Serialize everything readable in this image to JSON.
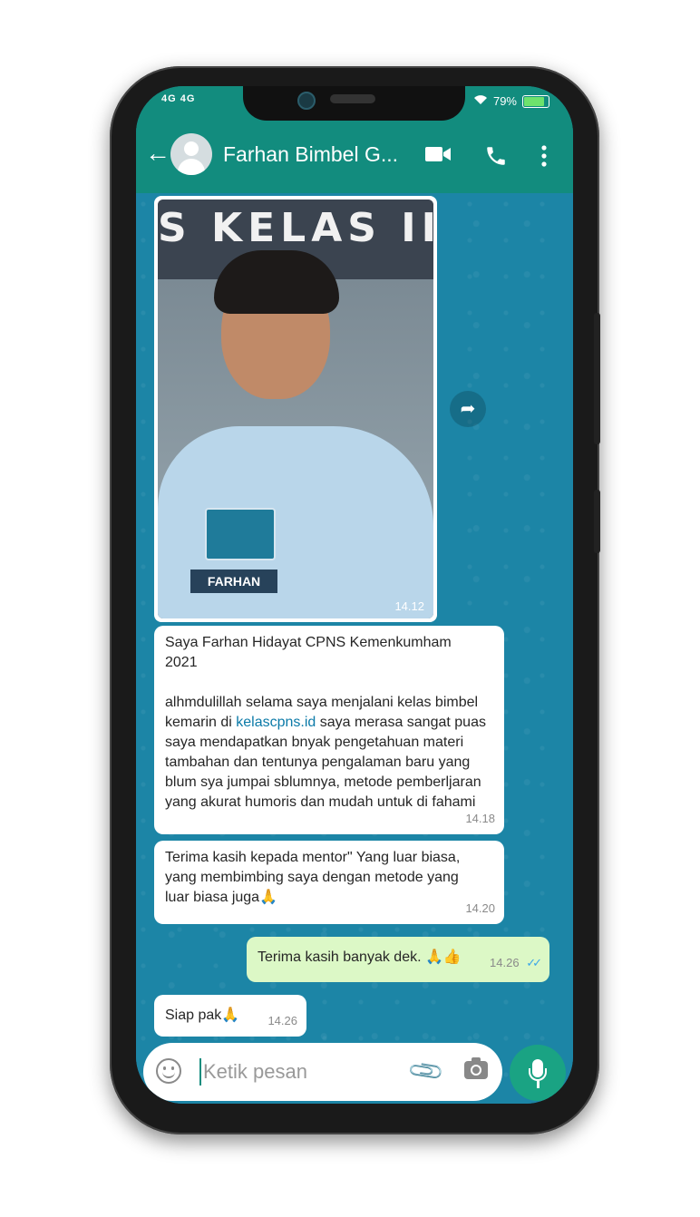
{
  "status_bar": {
    "network_left": "4G  4G",
    "battery_percent": "79%",
    "battery_level": 0.79
  },
  "header": {
    "back_icon": "arrow-left-icon",
    "contact_name": "Farhan Bimbel G...",
    "icons": [
      "video-call-icon",
      "phone-icon",
      "more-vert-icon"
    ]
  },
  "photo_message": {
    "sign_text": "S KELAS II",
    "badge_text": "FARHAN",
    "time": "14.12"
  },
  "messages": [
    {
      "direction": "in",
      "line1": "Saya Farhan Hidayat CPNS Kemenkumham",
      "line2": "2021",
      "para_before_link": "alhmdulillah selama saya menjalani kelas bimbel kemarin di ",
      "link": "kelascpns.id",
      "para_after_link": " saya merasa sangat puas saya mendapatkan bnyak pengetahuan materi tambahan dan tentunya pengalaman baru yang blum sya jumpai sblumnya, metode pemberljaran yang akurat humoris dan mudah untuk di fahami",
      "time": "14.18"
    },
    {
      "direction": "in",
      "text": "Terima kasih kepada mentor\" Yang luar biasa, yang membimbing saya dengan metode yang luar biasa juga🙏",
      "time": "14.20"
    },
    {
      "direction": "out",
      "text": "Terima kasih banyak dek. 🙏👍",
      "time": "14.26",
      "ticks": "✓✓"
    },
    {
      "direction": "in",
      "text": "Siap pak🙏",
      "time": "14.26"
    }
  ],
  "input": {
    "placeholder": "Ketik pesan"
  },
  "colors": {
    "header": "#128c7e",
    "chat_bg": "#1c85a6",
    "outgoing": "#dcf8c6",
    "mic": "#1aa383",
    "link": "#0b7aa8"
  }
}
